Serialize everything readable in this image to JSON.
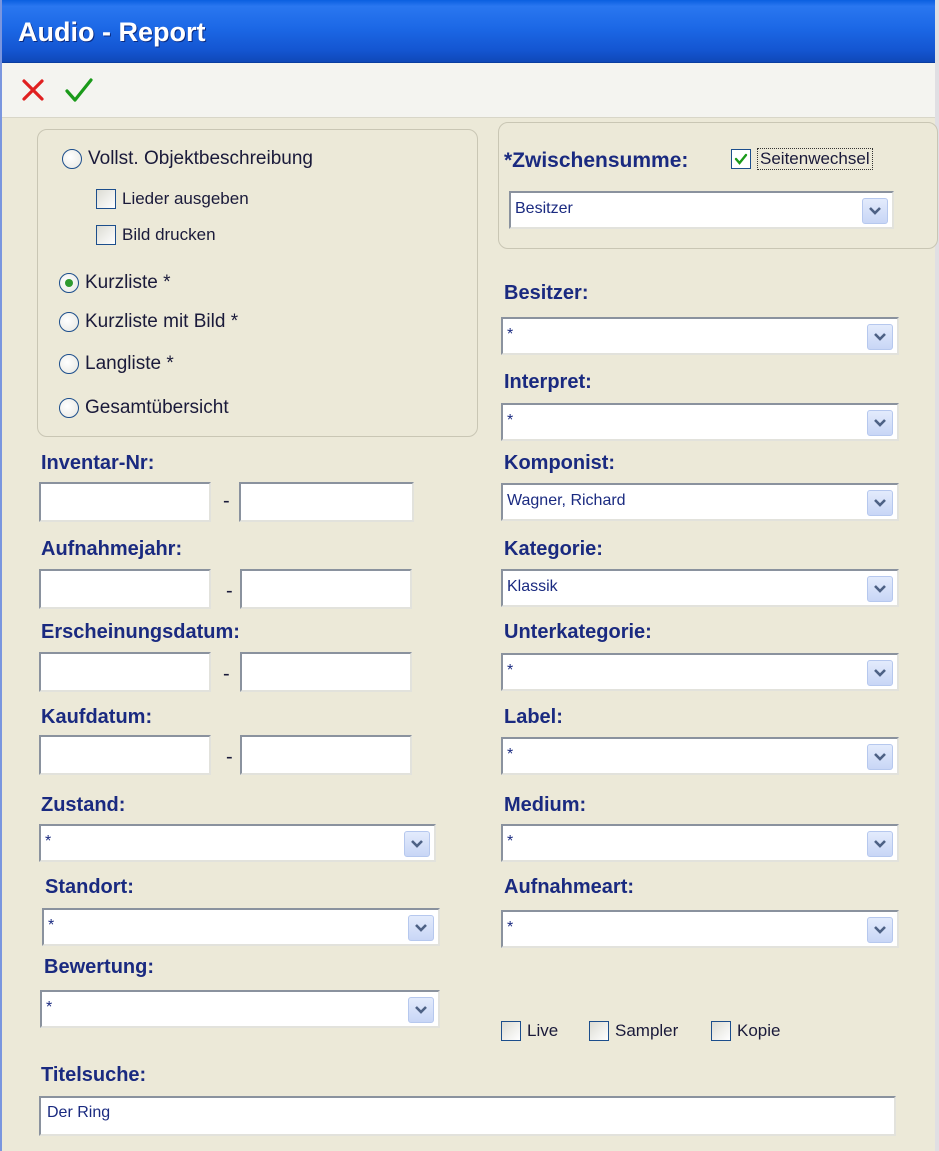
{
  "window": {
    "title": "Audio - Report"
  },
  "toolbar": {
    "cancel_icon": "close-icon",
    "ok_icon": "check-icon",
    "cancel_color": "#e02020",
    "ok_color": "#1a9a1a"
  },
  "report_type": {
    "full": "Vollst. Objektbeschreibung",
    "songs": "Lieder ausgeben",
    "picture": "Bild drucken",
    "short": "Kurzliste *",
    "short_pic": "Kurzliste mit Bild *",
    "long": "Langliste *",
    "overview": "Gesamtübersicht",
    "selected": "Kurzliste *"
  },
  "subtotal": {
    "label": "*Zwischensumme:",
    "pagebreak_label": "Seitenwechsel",
    "pagebreak_checked": true,
    "value": "Besitzer"
  },
  "left": {
    "inventar_label": "Inventar-Nr:",
    "aufnahmejahr_label": "Aufnahmejahr:",
    "erscheinungsdatum_label": "Erscheinungsdatum:",
    "kaufdatum_label": "Kaufdatum:",
    "separator": "-",
    "zustand_label": "Zustand:",
    "zustand_value": "*",
    "standort_label": "Standort:",
    "standort_value": "*",
    "bewertung_label": "Bewertung:",
    "bewertung_value": "*"
  },
  "right": {
    "besitzer_label": "Besitzer:",
    "besitzer_value": "*",
    "interpret_label": "Interpret:",
    "interpret_value": "*",
    "komponist_label": "Komponist:",
    "komponist_value": "Wagner, Richard",
    "kategorie_label": "Kategorie:",
    "kategorie_value": "Klassik",
    "unterkategorie_label": "Unterkategorie:",
    "unterkategorie_value": "*",
    "label_label": "Label:",
    "label_value": "*",
    "medium_label": "Medium:",
    "medium_value": "*",
    "aufnahmeart_label": "Aufnahmeart:",
    "aufnahmeart_value": "*"
  },
  "flags": {
    "live": "Live",
    "sampler": "Sampler",
    "kopie": "Kopie"
  },
  "titlesearch": {
    "label": "Titelsuche:",
    "value": "Der Ring"
  }
}
